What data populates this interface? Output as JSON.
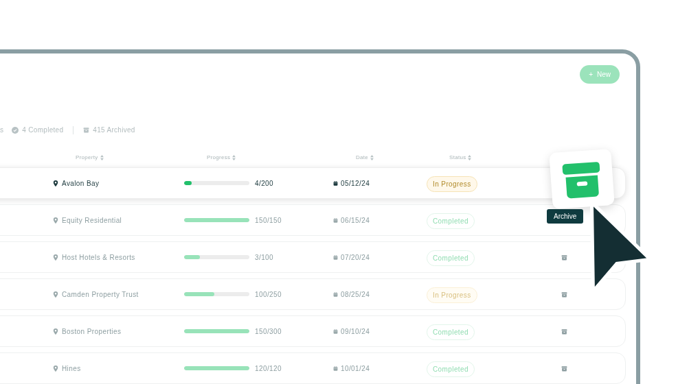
{
  "new_button": {
    "icon": "+",
    "label": "New"
  },
  "stats": [
    {
      "kind": "text",
      "label": "s"
    },
    {
      "kind": "completed",
      "label": "4 Completed"
    },
    {
      "kind": "archived",
      "label": "415 Archived"
    }
  ],
  "columns": [
    {
      "label": "Property"
    },
    {
      "label": "Progress"
    },
    {
      "label": "Date"
    },
    {
      "label": "Status"
    }
  ],
  "rows": [
    {
      "selected": true,
      "property": "Avalon Bay",
      "level": 0.12,
      "count": "4/200",
      "date": "05/12/24",
      "status": {
        "kind": "in_progress",
        "label": "In Progress"
      }
    },
    {
      "selected": false,
      "property": "Equity Residential",
      "level": 1,
      "count": "150/150",
      "date": "06/15/24",
      "status": {
        "kind": "completed",
        "label": "Completed"
      }
    },
    {
      "selected": false,
      "property": "Host Hotels & Resorts",
      "level": 0.24,
      "count": "3/100",
      "date": "07/20/24",
      "status": {
        "kind": "completed",
        "label": "Completed"
      },
      "archive_shown": true
    },
    {
      "selected": false,
      "property": "Camden Property Trust",
      "level": 0.46,
      "count": "100/250",
      "date": "08/25/24",
      "status": {
        "kind": "in_progress",
        "label": "In Progress"
      },
      "archive_shown": true
    },
    {
      "selected": false,
      "property": "Boston Properties",
      "level": 1,
      "count": "150/300",
      "date": "09/10/24",
      "status": {
        "kind": "completed",
        "label": "Completed"
      },
      "archive_shown": true
    },
    {
      "selected": false,
      "property": "Hines",
      "level": 1,
      "count": "120/120",
      "date": "10/01/24",
      "status": {
        "kind": "completed",
        "label": "Completed"
      },
      "archive_shown": true
    }
  ],
  "tooltip": {
    "label": "Archive"
  }
}
